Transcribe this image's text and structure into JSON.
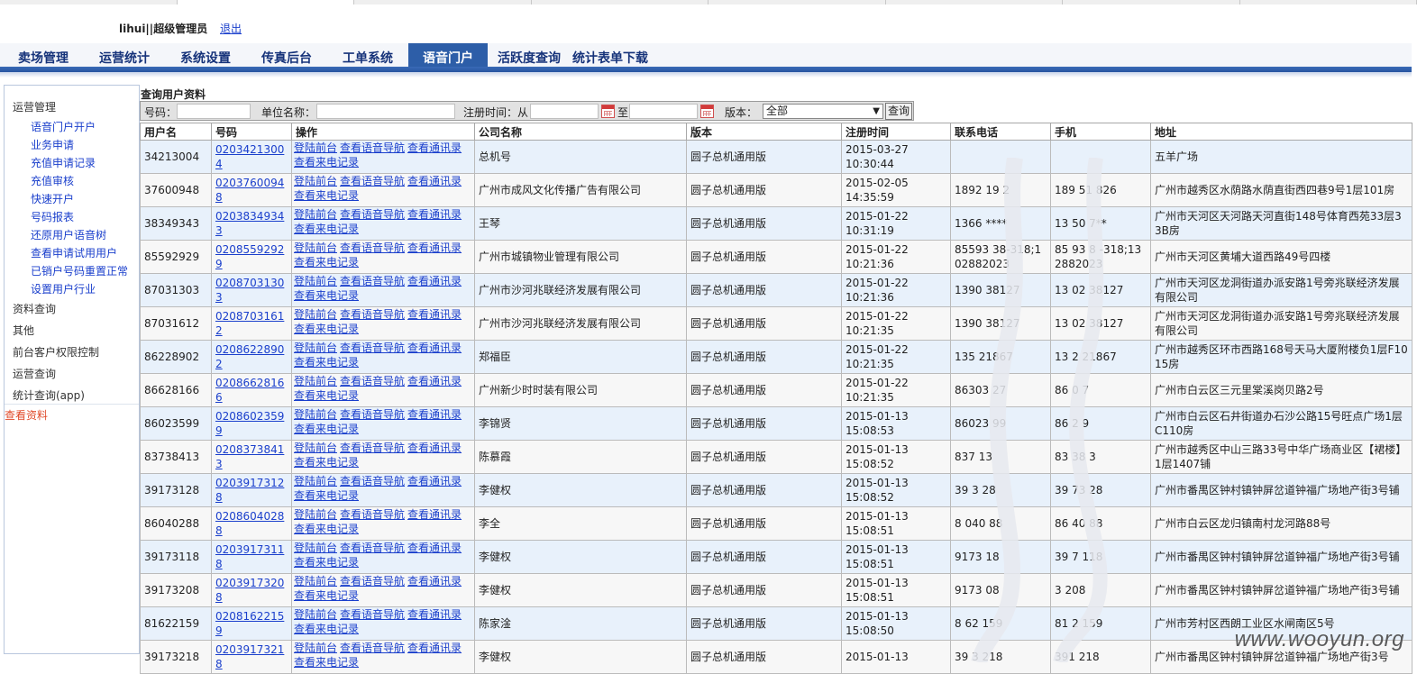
{
  "header": {
    "username": "lihui||超级管理员",
    "logout": "退出"
  },
  "nav": {
    "tabs": [
      "卖场管理",
      "运营统计",
      "系统设置",
      "传真后台",
      "工单系统",
      "语音门户",
      "活跃度查询",
      "统计表单下载"
    ],
    "active": "语音门户"
  },
  "sidebar": {
    "section1": "运营管理",
    "links": [
      "语音门户开户",
      "业务申请",
      "充值申请记录",
      "充值审核",
      "快速开户",
      "号码报表",
      "还原用户语音树",
      "查看申请试用用户",
      "已销户号码重置正常",
      "设置用户行业"
    ],
    "sections": [
      "资料查询",
      "其他",
      "前台客户权限控制",
      "运营查询",
      "统计查询(app)"
    ],
    "active": "查看资料"
  },
  "query": {
    "title": "查询用户资料",
    "number_label": "号码：",
    "company_label": "单位名称：",
    "reg_time_label": "注册时间：从",
    "to_label": "至",
    "version_label": "版本：",
    "version_value": "全部",
    "search_button": "查询"
  },
  "table": {
    "headers": [
      "用户名",
      "号码",
      "操作",
      "公司名称",
      "版本",
      "注册时间",
      "联系电话",
      "手机",
      "地址"
    ],
    "ops": [
      "登陆前台",
      "查看语音导航",
      "查看通讯录",
      "查看来电记录"
    ],
    "rows": [
      {
        "user": "34213004",
        "num": "02034213004",
        "company": "总机号",
        "version": "圆子总机通用版",
        "date": "2015-03-27",
        "time": "10:30:44",
        "phone": "",
        "mobile": "",
        "address": "五羊广场"
      },
      {
        "user": "37600948",
        "num": "02037600948",
        "company": "广州市成风文化传播广告有限公司",
        "version": "圆子总机通用版",
        "date": "2015-02-05",
        "time": "14:35:59",
        "phone": "1892 19  2",
        "mobile": "189 51 826",
        "address": "广州市越秀区水荫路水荫直街西四巷9号1层101房"
      },
      {
        "user": "38349343",
        "num": "02038349343",
        "company": "王琴",
        "version": "圆子总机通用版",
        "date": "2015-01-22",
        "time": "10:31:19",
        "phone": "1366    ****",
        "mobile": "13 50 7**",
        "address": "广州市天河区天河路天河直街148号体育西苑33层33B房"
      },
      {
        "user": "85592929",
        "num": "02085592929",
        "company": "广州市城镇物业管理有限公司",
        "version": "圆子总机通用版",
        "date": "2015-01-22",
        "time": "10:21:36",
        "phone": "85593 38-318;1  02882023",
        "mobile": "85 93 8 -318;13 2882023",
        "address": "广州市天河区黄埔大道西路49号四楼"
      },
      {
        "user": "87031303",
        "num": "02087031303",
        "company": "广州市沙河兆联经济发展有限公司",
        "version": "圆子总机通用版",
        "date": "2015-01-22",
        "time": "10:21:36",
        "phone": "1390  38127",
        "mobile": "13 02 38127",
        "address": "广州市天河区龙洞街道办派安路1号旁兆联经济发展有限公司"
      },
      {
        "user": "87031612",
        "num": "02087031612",
        "company": "广州市沙河兆联经济发展有限公司",
        "version": "圆子总机通用版",
        "date": "2015-01-22",
        "time": "10:21:35",
        "phone": "1390  38127",
        "mobile": "13 02 38127",
        "address": "广州市天河区龙洞街道办派安路1号旁兆联经济发展有限公司"
      },
      {
        "user": "86228902",
        "num": "02086228902",
        "company": "郑福臣",
        "version": "圆子总机通用版",
        "date": "2015-01-22",
        "time": "10:21:35",
        "phone": "135  21867",
        "mobile": "13 2 21867",
        "address": "广州市越秀区环市西路168号天马大厦附楼负1层F1015房"
      },
      {
        "user": "86628166",
        "num": "02086628166",
        "company": "广州新少时时装有限公司",
        "version": "圆子总机通用版",
        "date": "2015-01-22",
        "time": "10:21:35",
        "phone": "86303 27",
        "mobile": "86 0  7",
        "address": "广州市白云区三元里棠溪岗贝路2号"
      },
      {
        "user": "86023599",
        "num": "02086023599",
        "company": "李锦贤",
        "version": "圆子总机通用版",
        "date": "2015-01-13",
        "time": "15:08:53",
        "phone": "86023 99",
        "mobile": "86 2  9",
        "address": "广州市白云区石井街道办石沙公路15号旺点广场1层C110房"
      },
      {
        "user": "83738413",
        "num": "02083738413",
        "company": "陈慕霞",
        "version": "圆子总机通用版",
        "date": "2015-01-13",
        "time": "15:08:52",
        "phone": "837  13",
        "mobile": "83 38  3",
        "address": "广州市越秀区中山三路33号中华广场商业区【裙楼】1层1407铺"
      },
      {
        "user": "39173128",
        "num": "02039173128",
        "company": "李健权",
        "version": "圆子总机通用版",
        "date": "2015-01-13",
        "time": "15:08:52",
        "phone": "39 3 28",
        "mobile": "39 73 28",
        "address": "广州市番禺区钟村镇钟屏岔道钟福广场地产街3号铺"
      },
      {
        "user": "86040288",
        "num": "02086040288",
        "company": "李全",
        "version": "圆子总机通用版",
        "date": "2015-01-13",
        "time": "15:08:51",
        "phone": "8 040 88",
        "mobile": "86 40 88",
        "address": "广州市白云区龙归镇南村龙河路88号"
      },
      {
        "user": "39173118",
        "num": "02039173118",
        "company": "李健权",
        "version": "圆子总机通用版",
        "date": "2015-01-13",
        "time": "15:08:51",
        "phone": "9173 18",
        "mobile": "39 7 118",
        "address": "广州市番禺区钟村镇钟屏岔道钟福广场地产街3号铺"
      },
      {
        "user": "39173208",
        "num": "02039173208",
        "company": "李健权",
        "version": "圆子总机通用版",
        "date": "2015-01-13",
        "time": "15:08:51",
        "phone": "9173 08",
        "mobile": "3  208",
        "address": "广州市番禺区钟村镇钟屏岔道钟福广场地产街3号铺"
      },
      {
        "user": "81622159",
        "num": "02081622159",
        "company": "陈家淦",
        "version": "圆子总机通用版",
        "date": "2015-01-13",
        "time": "15:08:50",
        "phone": "8 62 159",
        "mobile": "81 2 159",
        "address": "广州市芳村区西朗工业区水闸南区5号"
      },
      {
        "user": "39173218",
        "num": "02039173218",
        "company": "李健权",
        "version": "圆子总机通用版",
        "date": "2015-01-13",
        "time": "",
        "phone": "39 3 218",
        "mobile": "391 218",
        "address": "广州市番禺区钟村镇钟屏岔道钟福广场地产街3号"
      }
    ]
  },
  "watermark": "www.wooyun.org"
}
